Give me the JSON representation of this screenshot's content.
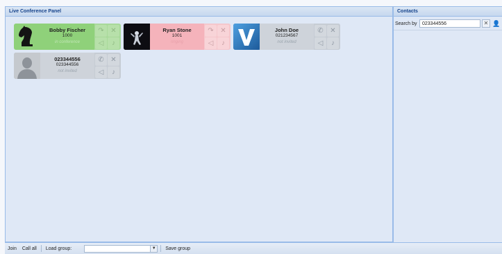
{
  "conference": {
    "title": "Live Conference Panel",
    "participants": [
      {
        "name": "Bobby Fischer",
        "number": "1000",
        "status": "in conference",
        "state": "in-conference",
        "avatar": "chess-knight"
      },
      {
        "name": "Ryan Stone",
        "number": "1001",
        "status": "ringing",
        "state": "ringing",
        "avatar": "astronaut"
      },
      {
        "name": "John Doe",
        "number": "021234567",
        "status": "not invited",
        "state": "not-invited",
        "avatar": "v-logo"
      },
      {
        "name": "023344556",
        "number": "023344556",
        "status": "not invited",
        "state": "not-invited",
        "avatar": "silhouette"
      }
    ],
    "action_icons": [
      "hangup-icon",
      "remove-icon",
      "mute-icon",
      "microphone-icon"
    ]
  },
  "contacts": {
    "title": "Contacts",
    "search_label": "Search by",
    "search_value": "023344556",
    "clear_icon": "clear-icon",
    "add_contact_icon": "user-icon"
  },
  "toolbar": {
    "join_label": "Join",
    "call_all_label": "Call all",
    "load_group_label": "Load group:",
    "load_group_value": "",
    "save_group_label": "Save group"
  },
  "colors": {
    "in_conference": "#8fd17a",
    "ringing": "#f5b3bb",
    "not_invited": "#ced3da",
    "header_text": "#15428b"
  }
}
